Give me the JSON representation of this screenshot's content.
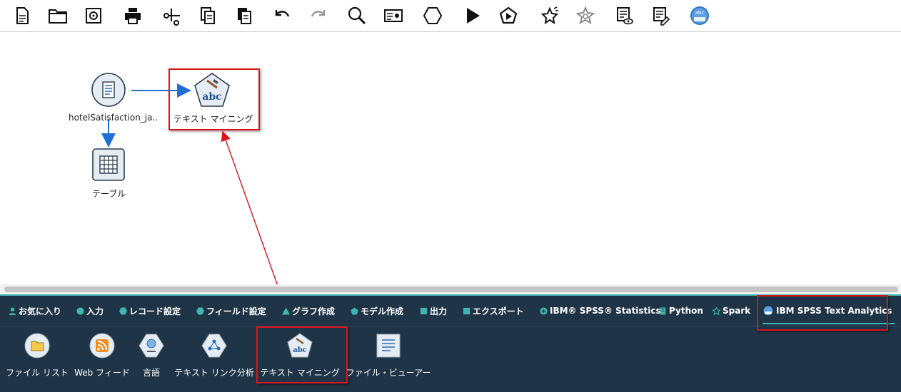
{
  "toolbar": {
    "buttons": [
      {
        "name": "new-stream-icon"
      },
      {
        "name": "open-folder-icon"
      },
      {
        "name": "save-icon"
      },
      {
        "name": "print-icon"
      },
      {
        "name": "cut-icon"
      },
      {
        "name": "copy-icon"
      },
      {
        "name": "paste-icon"
      },
      {
        "name": "undo-icon"
      },
      {
        "name": "redo-icon"
      },
      {
        "name": "search-icon"
      },
      {
        "name": "properties-icon"
      },
      {
        "name": "supernode-icon"
      },
      {
        "name": "run-icon"
      },
      {
        "name": "run-selection-icon"
      },
      {
        "name": "magic-wand-icon"
      },
      {
        "name": "settings-star-icon"
      },
      {
        "name": "annotation-view-icon"
      },
      {
        "name": "annotation-edit-icon"
      },
      {
        "name": "text-analytics-icon"
      }
    ],
    "text_icon_label": "abc"
  },
  "canvas": {
    "nodes": {
      "source": {
        "label": "hotelSatisfaction_ja.."
      },
      "text_mining": {
        "label": "テキスト マイニング",
        "icon_text": "abc"
      },
      "table": {
        "label": "テーブル"
      }
    }
  },
  "palette": {
    "tabs": [
      {
        "label": "お気に入り",
        "icon": "person-icon"
      },
      {
        "label": "入力",
        "icon": "circle-icon"
      },
      {
        "label": "レコード設定",
        "icon": "hexagon-icon"
      },
      {
        "label": "フィールド設定",
        "icon": "hexagon-icon"
      },
      {
        "label": "グラフ作成",
        "icon": "triangle-icon"
      },
      {
        "label": "モデル作成",
        "icon": "pentagon-icon"
      },
      {
        "label": "出力",
        "icon": "square-icon"
      },
      {
        "label": "エクスポート",
        "icon": "square-icon"
      },
      {
        "label": "IBM® SPSS® Statistics",
        "icon": "spss-icon"
      },
      {
        "label": "Python",
        "icon": "python-icon"
      },
      {
        "label": "Spark",
        "icon": "spark-icon"
      },
      {
        "label": "IBM SPSS Text Analytics",
        "icon": "text-analytics-icon",
        "active": true
      }
    ],
    "items": [
      {
        "label": "ファイル リスト",
        "icon": "file-list-icon"
      },
      {
        "label": "Web フィード",
        "icon": "rss-icon"
      },
      {
        "label": "言語",
        "icon": "language-icon"
      },
      {
        "label": "テキスト リンク分析",
        "icon": "text-link-icon"
      },
      {
        "label": "テキスト マイニング",
        "icon": "text-mining-icon",
        "icon_text": "abc"
      },
      {
        "label": "ファイル・ビューアー",
        "icon": "file-viewer-icon"
      }
    ]
  },
  "colors": {
    "palette_bg": "#1f3446",
    "accent": "#3fb7b0",
    "highlight": "#d9141c",
    "link": "#1e6fd4"
  }
}
